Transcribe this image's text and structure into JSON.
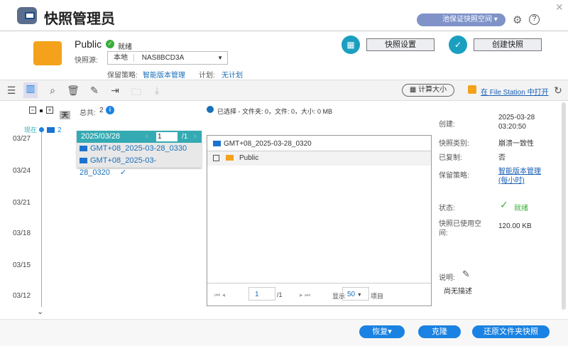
{
  "app": {
    "title": "快照管理员",
    "pool_label": "池保证快照空间"
  },
  "share": {
    "name": "Public",
    "status": "就绪",
    "source_label": "快照源:",
    "source_type": "本地",
    "source_device": "NAS8BCD3A",
    "retention_label": "保留策略:",
    "retention_value": "智能版本管理",
    "schedule_label": "计划:",
    "schedule_value": "无计划"
  },
  "actions": {
    "settings": "快照设置",
    "create": "创建快照"
  },
  "toolbar": {
    "calc_size": "计算大小",
    "open_fs": "在 File Station 中打开"
  },
  "timeline": {
    "zoom_unit": "天",
    "total_label": "总共:",
    "total": "2",
    "now_label": "现在",
    "now_count": "2",
    "dates": [
      "03/27",
      "03/24",
      "03/21",
      "03/18",
      "03/15",
      "03/12"
    ]
  },
  "popup": {
    "date": "2025/03/28",
    "page": "1",
    "pages": "/1",
    "snapshots": [
      "GMT+08_2025-03-28_0330",
      "GMT+08_2025-03-28_0320"
    ]
  },
  "files": {
    "selection": "已选择 - 文件夹: 0，文件: 0，大小: 0 MB",
    "snapshot": "GMT+08_2025-03-28_0320",
    "items": [
      "Public"
    ],
    "page": "1",
    "pages": "/1",
    "show_label": "显示",
    "per_page": "50",
    "items_label": "项目"
  },
  "details": {
    "created_label": "创建:",
    "created_date": "2025-03-28",
    "created_time": "03:20:50",
    "type_label": "快照类别:",
    "type": "崩溃一致性",
    "replicated_label": "已复制:",
    "replicated": "否",
    "retention_label": "保留策略:",
    "retention": "智能版本管理",
    "retention2": "(每小时)",
    "status_label": "状态:",
    "status": "就绪",
    "used_label": "快照已使用空",
    "used_label2": "间:",
    "used": "120.00 KB",
    "desc_label": "说明:",
    "desc": "尚无描述"
  },
  "footer": {
    "restore": "恢复▾",
    "clone": "克隆",
    "revert": "还原文件夹快照"
  }
}
